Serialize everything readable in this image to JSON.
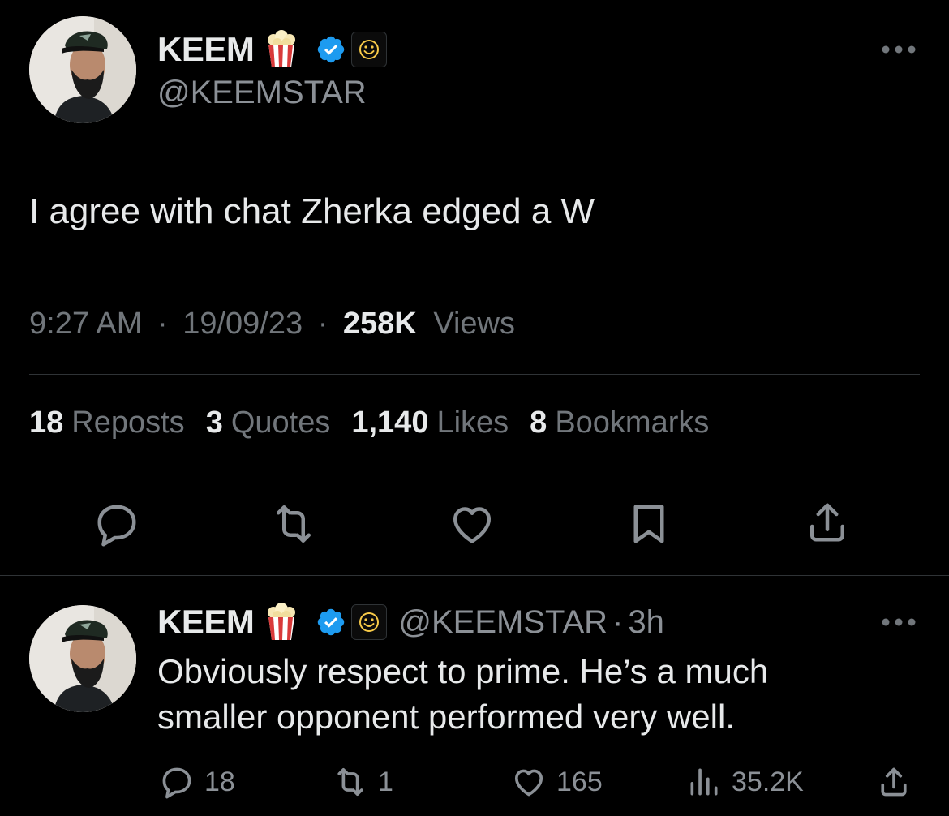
{
  "main_tweet": {
    "author": {
      "display_name": "KEEM",
      "handle": "@KEEMSTAR"
    },
    "text": "I agree with chat Zherka edged a W",
    "time": "9:27 AM",
    "date": "19/09/23",
    "views_count": "258K",
    "views_label": "Views",
    "stats": [
      {
        "count": "18",
        "label": "Reposts"
      },
      {
        "count": "3",
        "label": "Quotes"
      },
      {
        "count": "1,140",
        "label": "Likes"
      },
      {
        "count": "8",
        "label": "Bookmarks"
      }
    ]
  },
  "reply": {
    "author": {
      "display_name": "KEEM",
      "handle": "@KEEMSTAR",
      "time": "3h"
    },
    "text_line1": "Obviously respect to prime. He’s a much",
    "text_line2": "smaller opponent performed very well.",
    "replies": "18",
    "reposts": "1",
    "likes": "165",
    "views": "35.2K"
  },
  "separator": "·",
  "colors": {
    "background": "#000000",
    "text_primary": "#e7e9ea",
    "text_secondary": "#71767b",
    "verified": "#1d9bf0",
    "divider": "#2f3336",
    "affiliate_badge": "#f7c948"
  },
  "icons": [
    "popcorn-icon",
    "verified-icon",
    "affiliate-smiley-icon",
    "more-icon",
    "reply-icon",
    "repost-icon",
    "like-icon",
    "bookmark-icon",
    "share-icon",
    "views-icon"
  ]
}
